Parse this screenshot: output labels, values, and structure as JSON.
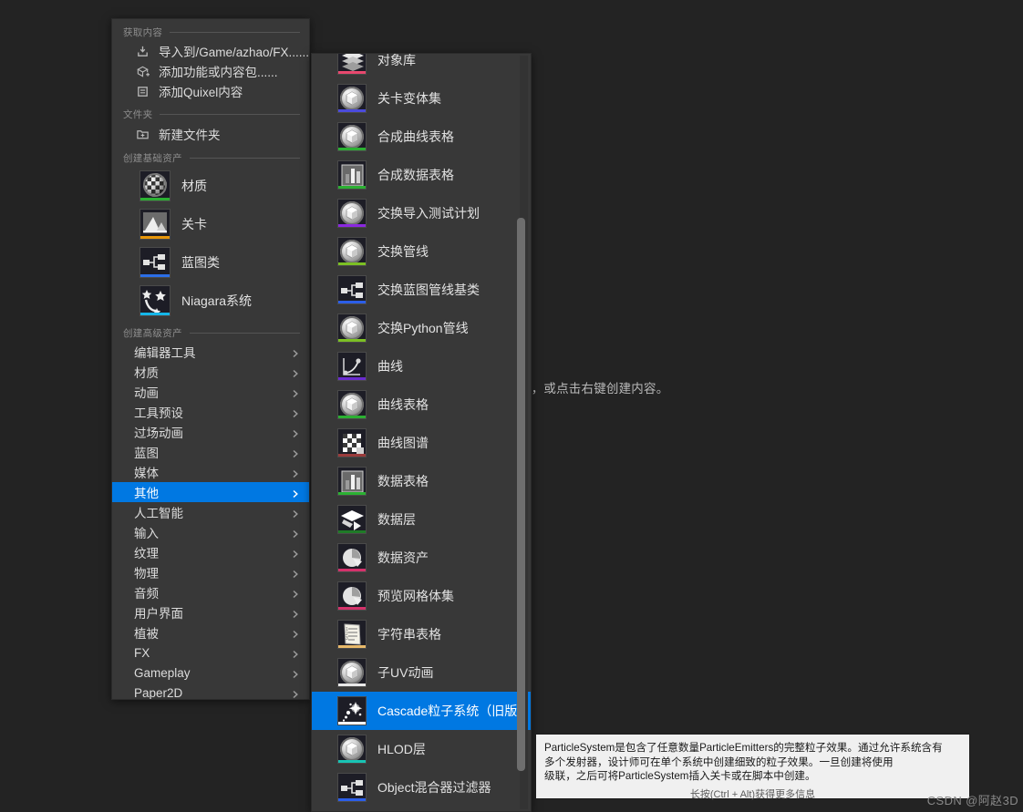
{
  "background": {
    "hint_text": "处，或点击右键创建内容。"
  },
  "context_menu": {
    "sections": [
      {
        "title": "获取内容",
        "items": [
          {
            "label": "导入到/Game/azhao/FX......",
            "icon": "import-icon"
          },
          {
            "label": "添加功能或内容包......",
            "icon": "add-feature-icon"
          },
          {
            "label": "添加Quixel内容",
            "icon": "quixel-icon"
          }
        ]
      },
      {
        "title": "文件夹",
        "items": [
          {
            "label": "新建文件夹",
            "icon": "new-folder-icon"
          }
        ]
      }
    ],
    "basic_assets": {
      "title": "创建基础资产",
      "items": [
        {
          "label": "材质",
          "icon": "material-sphere-icon",
          "bar_color": "#2bb032"
        },
        {
          "label": "关卡",
          "icon": "level-icon",
          "bar_color": "#e8960a"
        },
        {
          "label": "蓝图类",
          "icon": "blueprint-class-icon",
          "bar_color": "#2b6ee8"
        },
        {
          "label": "Niagara系统",
          "icon": "niagara-system-icon",
          "bar_color": "#15b6e8"
        }
      ]
    },
    "advanced_assets": {
      "title": "创建高级资产",
      "items": [
        {
          "label": "编辑器工具",
          "selected": false
        },
        {
          "label": "材质",
          "selected": false
        },
        {
          "label": "动画",
          "selected": false
        },
        {
          "label": "工具预设",
          "selected": false
        },
        {
          "label": "过场动画",
          "selected": false
        },
        {
          "label": "蓝图",
          "selected": false
        },
        {
          "label": "媒体",
          "selected": false
        },
        {
          "label": "其他",
          "selected": true
        },
        {
          "label": "人工智能",
          "selected": false
        },
        {
          "label": "输入",
          "selected": false
        },
        {
          "label": "纹理",
          "selected": false
        },
        {
          "label": "物理",
          "selected": false
        },
        {
          "label": "音频",
          "selected": false
        },
        {
          "label": "用户界面",
          "selected": false
        },
        {
          "label": "植被",
          "selected": false
        },
        {
          "label": "FX",
          "selected": false
        },
        {
          "label": "Gameplay",
          "selected": false
        },
        {
          "label": "Paper2D",
          "selected": false
        }
      ]
    }
  },
  "submenu": {
    "items": [
      {
        "label": "对象库",
        "icon": "object-library-icon",
        "bar_color": "#e8486e",
        "selected": false
      },
      {
        "label": "关卡变体集",
        "icon": "cube-icon",
        "bar_color": "#4b4bdc",
        "selected": false
      },
      {
        "label": "合成曲线表格",
        "icon": "cube-icon",
        "bar_color": "#2bb032",
        "selected": false
      },
      {
        "label": "合成数据表格",
        "icon": "data-table-icon",
        "bar_color": "#2bb032",
        "selected": false
      },
      {
        "label": "交换导入测试计划",
        "icon": "cube-icon",
        "bar_color": "#8b28e0",
        "selected": false
      },
      {
        "label": "交换管线",
        "icon": "cube-icon",
        "bar_color": "#7cc024",
        "selected": false
      },
      {
        "label": "交换蓝图管线基类",
        "icon": "blueprint-class-icon",
        "bar_color": "#2b5ee8",
        "selected": false
      },
      {
        "label": "交换Python管线",
        "icon": "cube-icon",
        "bar_color": "#7cc024",
        "selected": false
      },
      {
        "label": "曲线",
        "icon": "curve-icon",
        "bar_color": "#6a2bd0",
        "selected": false
      },
      {
        "label": "曲线表格",
        "icon": "cube-icon",
        "bar_color": "#2bb032",
        "selected": false
      },
      {
        "label": "曲线图谱",
        "icon": "curve-atlas-icon",
        "bar_color": "#9b3b3b",
        "selected": false
      },
      {
        "label": "数据表格",
        "icon": "data-table-icon",
        "bar_color": "#2bb032",
        "selected": false
      },
      {
        "label": "数据层",
        "icon": "data-layer-icon",
        "bar_color": "#1f7a27",
        "selected": false
      },
      {
        "label": "数据资产",
        "icon": "pie-icon",
        "bar_color": "#d4326b",
        "selected": false
      },
      {
        "label": "预览网格体集",
        "icon": "pie-icon",
        "bar_color": "#d4326b",
        "selected": false
      },
      {
        "label": "字符串表格",
        "icon": "string-table-icon",
        "bar_color": "#e8b96a",
        "selected": false
      },
      {
        "label": "子UV动画",
        "icon": "cube-icon",
        "bar_color": "#e8e8e8",
        "selected": false
      },
      {
        "label": "Cascade粒子系统（旧版）",
        "icon": "particle-system-icon",
        "bar_color": "#ffffff",
        "selected": true
      },
      {
        "label": "HLOD层",
        "icon": "cube-icon",
        "bar_color": "#18c4b4",
        "selected": false
      },
      {
        "label": "Object混合器过滤器",
        "icon": "blueprint-class-icon",
        "bar_color": "#2b5ee8",
        "selected": false
      }
    ],
    "scrollbar": {
      "visible": true
    }
  },
  "tooltip": {
    "line1": "ParticleSystem是包含了任意数量ParticleEmitters的完整粒子效果。通过允许系统含有",
    "line2": "多个发射器，设计师可在单个系统中创建细致的粒子效果。一旦创建将使用",
    "line3": "级联，之后可将ParticleSystem插入关卡或在脚本中创建。",
    "footer": "长按(Ctrl + Alt)获得更多信息"
  },
  "watermark": {
    "text": "CSDN @阿赵3D"
  },
  "colors": {
    "accent": "#0078e2",
    "panel_bg": "#383838",
    "canvas_bg": "#232323",
    "text": "#dcdcdc"
  }
}
